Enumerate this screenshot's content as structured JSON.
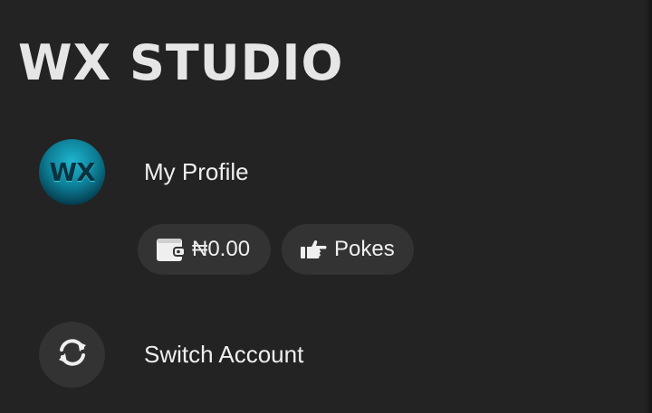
{
  "app": {
    "title": "WX STUDIO"
  },
  "profile": {
    "avatar_text": "WX",
    "label": "My Profile",
    "avatar_icon": "wx-avatar",
    "colors": {
      "avatar_accent": "#0d7f97"
    }
  },
  "chips": {
    "balance": {
      "icon": "wallet-icon",
      "value": "₦0.00"
    },
    "pokes": {
      "icon": "pointing-hand-icon",
      "label": "Pokes"
    }
  },
  "switch_account": {
    "icon": "sync-icon",
    "label": "Switch Account"
  },
  "theme": {
    "background": "#232323",
    "surface": "#333333",
    "text": "#efefef"
  }
}
